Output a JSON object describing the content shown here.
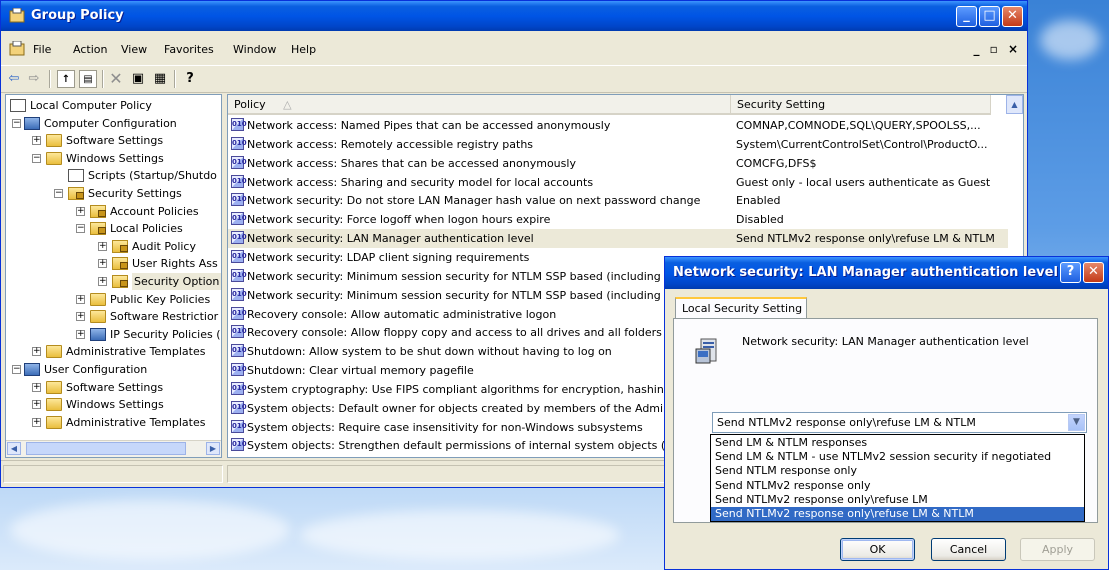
{
  "main_window": {
    "title": "Group Policy",
    "menu": [
      "File",
      "Action",
      "View",
      "Favorites",
      "Window",
      "Help"
    ],
    "mdi_controls": "_ ▫ ×"
  },
  "tree": {
    "items": [
      {
        "label": "Local Computer Policy",
        "depth": 0,
        "expander": "",
        "icon": "policy-icon"
      },
      {
        "label": "Computer Configuration",
        "depth": 0,
        "expander": "−",
        "icon": "computer-icon"
      },
      {
        "label": "Software Settings",
        "depth": 1,
        "expander": "+",
        "icon": "folder-icon"
      },
      {
        "label": "Windows Settings",
        "depth": 1,
        "expander": "−",
        "icon": "folder-icon"
      },
      {
        "label": "Scripts (Startup/Shutdo",
        "depth": 2,
        "expander": "",
        "icon": "script-icon"
      },
      {
        "label": "Security Settings",
        "depth": 2,
        "expander": "−",
        "icon": "security-icon"
      },
      {
        "label": "Account Policies",
        "depth": 3,
        "expander": "+",
        "icon": "lock-folder-icon"
      },
      {
        "label": "Local Policies",
        "depth": 3,
        "expander": "−",
        "icon": "lock-folder-icon"
      },
      {
        "label": "Audit Policy",
        "depth": 4,
        "expander": "+",
        "icon": "lock-folder-icon"
      },
      {
        "label": "User Rights Ass",
        "depth": 4,
        "expander": "+",
        "icon": "lock-folder-icon"
      },
      {
        "label": "Security Option",
        "depth": 4,
        "expander": "+",
        "icon": "lock-folder-icon",
        "selected": true
      },
      {
        "label": "Public Key Policies",
        "depth": 3,
        "expander": "+",
        "icon": "folder-icon"
      },
      {
        "label": "Software Restrictior",
        "depth": 3,
        "expander": "+",
        "icon": "folder-icon"
      },
      {
        "label": "IP Security Policies (",
        "depth": 3,
        "expander": "+",
        "icon": "ipsec-icon"
      },
      {
        "label": "Administrative Templates",
        "depth": 1,
        "expander": "+",
        "icon": "folder-icon"
      },
      {
        "label": "User Configuration",
        "depth": 0,
        "expander": "−",
        "icon": "user-icon"
      },
      {
        "label": "Software Settings",
        "depth": 1,
        "expander": "+",
        "icon": "folder-icon"
      },
      {
        "label": "Windows Settings",
        "depth": 1,
        "expander": "+",
        "icon": "folder-icon"
      },
      {
        "label": "Administrative Templates",
        "depth": 1,
        "expander": "+",
        "icon": "folder-icon"
      }
    ]
  },
  "list": {
    "columns": {
      "policy": "Policy",
      "setting": "Security Setting"
    },
    "rows": [
      {
        "policy": "Network access: Named Pipes that can be accessed anonymously",
        "setting": "COMNAP,COMNODE,SQL\\QUERY,SPOOLSS,..."
      },
      {
        "policy": "Network access: Remotely accessible registry paths",
        "setting": "System\\CurrentControlSet\\Control\\ProductO..."
      },
      {
        "policy": "Network access: Shares that can be accessed anonymously",
        "setting": "COMCFG,DFS$"
      },
      {
        "policy": "Network access: Sharing and security model for local accounts",
        "setting": "Guest only - local users authenticate as Guest"
      },
      {
        "policy": "Network security: Do not store LAN Manager hash value on next password change",
        "setting": "Enabled"
      },
      {
        "policy": "Network security: Force logoff when logon hours expire",
        "setting": "Disabled"
      },
      {
        "policy": "Network security: LAN Manager authentication level",
        "setting": "Send NTLMv2 response only\\refuse LM & NTLM",
        "selected": true
      },
      {
        "policy": "Network security: LDAP client signing requirements",
        "setting": ""
      },
      {
        "policy": "Network security: Minimum session security for NTLM SSP based (including secu",
        "setting": ""
      },
      {
        "policy": "Network security: Minimum session security for NTLM SSP based (including secu",
        "setting": ""
      },
      {
        "policy": "Recovery console: Allow automatic administrative logon",
        "setting": ""
      },
      {
        "policy": "Recovery console: Allow floppy copy and access to all drives and all folders",
        "setting": ""
      },
      {
        "policy": "Shutdown: Allow system to be shut down without having to log on",
        "setting": ""
      },
      {
        "policy": "Shutdown: Clear virtual memory pagefile",
        "setting": ""
      },
      {
        "policy": "System cryptography: Use FIPS compliant algorithms for encryption, hashing, ...",
        "setting": ""
      },
      {
        "policy": "System objects: Default owner for objects created by members of the Administ",
        "setting": ""
      },
      {
        "policy": "System objects: Require case insensitivity for non-Windows subsystems",
        "setting": ""
      },
      {
        "policy": "System objects: Strengthen default permissions of internal system objects (e.g.",
        "setting": ""
      }
    ]
  },
  "dialog": {
    "title": "Network security: LAN Manager authentication level ...",
    "tab": "Local Security Setting",
    "description": "Network security: LAN Manager authentication level",
    "combo_value": "Send NTLMv2 response only\\refuse LM & NTLM",
    "options": [
      "Send LM & NTLM responses",
      "Send LM & NTLM - use NTLMv2 session security if negotiated",
      "Send NTLM response only",
      "Send NTLMv2 response only",
      "Send NTLMv2 response only\\refuse LM",
      "Send NTLMv2 response only\\refuse LM & NTLM"
    ],
    "selected_option": 5,
    "buttons": {
      "ok": "OK",
      "cancel": "Cancel",
      "apply": "Apply"
    }
  },
  "colors": {
    "title_blue": "#0055e5",
    "selection_blue": "#316ac5",
    "window_face": "#ece9d8"
  }
}
